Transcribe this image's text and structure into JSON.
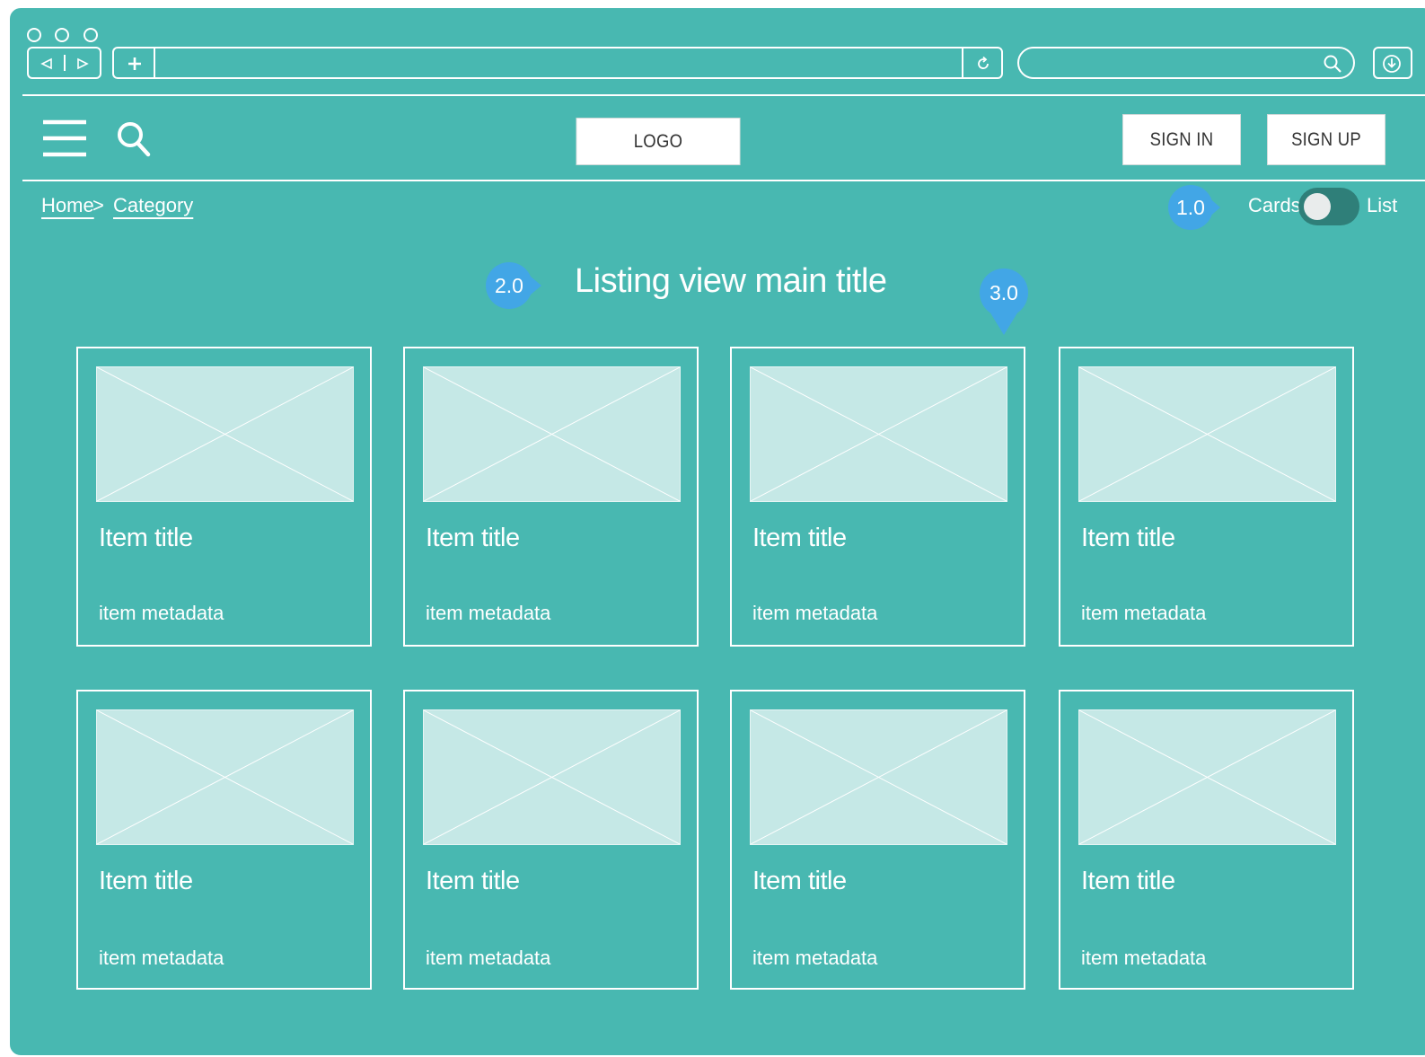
{
  "browser": {
    "window_controls": [
      "circle",
      "circle",
      "circle"
    ],
    "nav_icons": [
      "back-triangle-icon",
      "forward-triangle-icon"
    ],
    "new_tab_icon": "plus-icon",
    "refresh_icon": "refresh-icon",
    "search_icon": "search-icon",
    "download_icon": "download-icon",
    "address_value": "",
    "search_value": ""
  },
  "header": {
    "menu_icon": "hamburger-menu-icon",
    "search_icon": "search-icon",
    "logo_label": "LOGO",
    "sign_in_label": "SIGN IN",
    "sign_up_label": "SIGN UP"
  },
  "breadcrumb": {
    "items": [
      "Home",
      "Category"
    ],
    "separator": ">"
  },
  "view_toggle": {
    "left_label": "Cards",
    "right_label": "List",
    "selected": "Cards"
  },
  "markers": [
    "1.0",
    "2.0",
    "3.0"
  ],
  "main": {
    "title": "Listing view main title"
  },
  "cards": [
    {
      "title": "Item title",
      "meta": "item metadata"
    },
    {
      "title": "Item title",
      "meta": "item metadata"
    },
    {
      "title": "Item title",
      "meta": "item metadata"
    },
    {
      "title": "Item title",
      "meta": "item metadata"
    },
    {
      "title": "Item title",
      "meta": "item metadata"
    },
    {
      "title": "Item title",
      "meta": "item metadata"
    },
    {
      "title": "Item title",
      "meta": "item metadata"
    },
    {
      "title": "Item title",
      "meta": "item metadata"
    }
  ],
  "colors": {
    "background": "#48b8b1",
    "marker": "#42a6e6",
    "placeholder": "#c5e8e6",
    "toggle_track": "#2f7f79"
  }
}
